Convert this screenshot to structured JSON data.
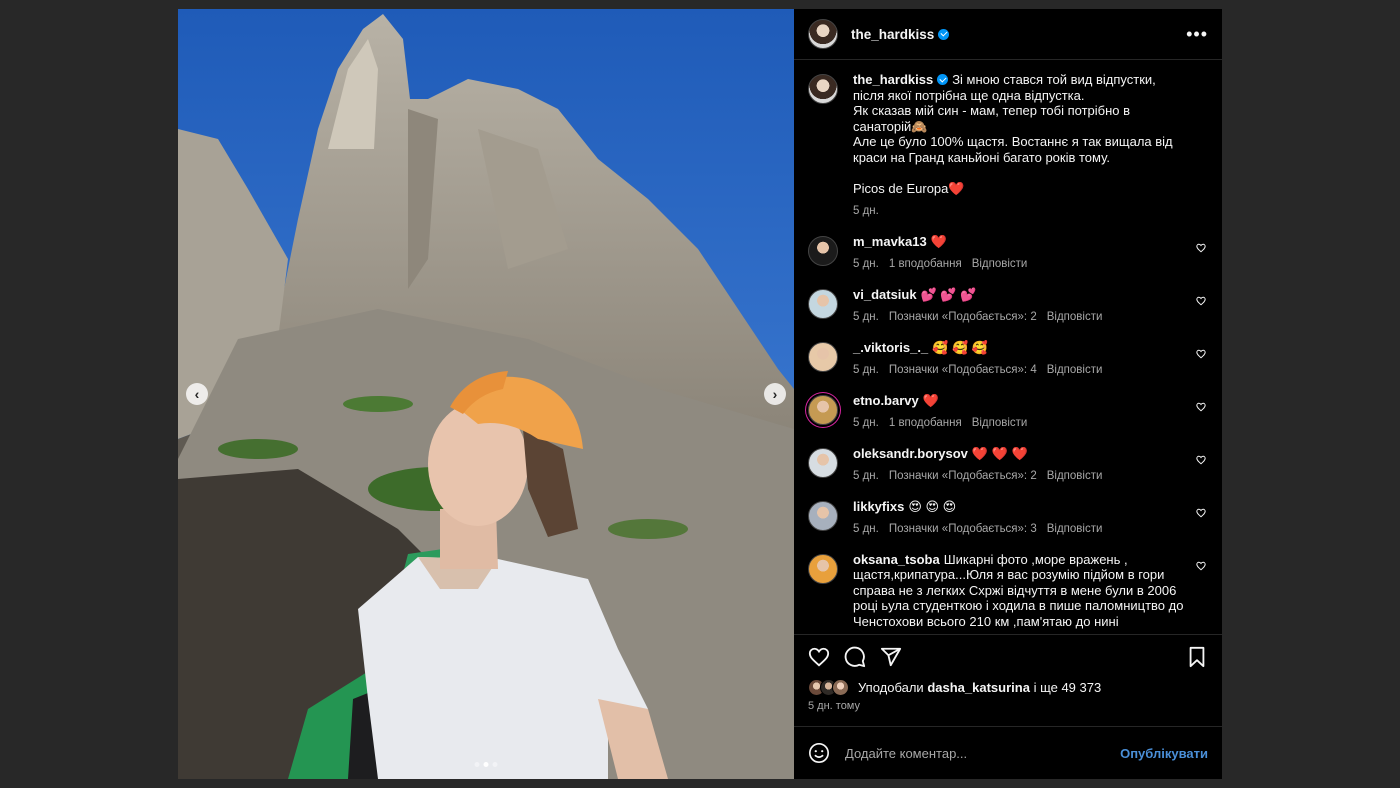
{
  "post": {
    "author": "the_hardkiss",
    "caption": "Зі мною стався той вид відпустки, після якої потрібна ще одна відпустка.\nЯк сказав мій син - мам, тепер тобі потрібно в санаторій🙈\nАле це було 100% щастя. Востаннє я так вищала від краси на Гранд каньйоні багато років тому.\n\nPicos de Europa",
    "caption_heart": "❤️",
    "caption_time": "5 дн."
  },
  "comments": [
    {
      "user": "m_mavka13",
      "text": "❤️",
      "time": "5 дн.",
      "likes": "1 вподобання",
      "reply": "Відповісти"
    },
    {
      "user": "vi_datsiuk",
      "text": "💕 💕 💕",
      "time": "5 дн.",
      "likes": "Позначки «Подобається»: 2",
      "reply": "Відповісти"
    },
    {
      "user": "_.viktoris_._",
      "text": "🥰 🥰 🥰",
      "time": "5 дн.",
      "likes": "Позначки «Подобається»: 4",
      "reply": "Відповісти"
    },
    {
      "user": "etno.barvy",
      "text": "❤️",
      "time": "5 дн.",
      "likes": "1 вподобання",
      "reply": "Відповісти"
    },
    {
      "user": "oleksandr.borysov",
      "text": "❤️ ❤️ ❤️",
      "time": "5 дн.",
      "likes": "Позначки «Подобається»: 2",
      "reply": "Відповісти"
    },
    {
      "user": "likkyfixs",
      "text": "😍 😍 😍",
      "time": "5 дн.",
      "likes": "Позначки «Подобається»: 3",
      "reply": "Відповісти"
    },
    {
      "user": "oksana_tsoba",
      "text": "Шикарні фото ,море вражень , щастя,крипатура...Юля я вас розумію підйом в гори справа не з легких Схржі відчуття в мене були в 2006 році ьула студенткою і ходила в пише паломництво до Ченстохови всього 210 км ,пам'ятаю до нині",
      "time": "",
      "likes": "",
      "reply": ""
    }
  ],
  "likes": {
    "prefix": "Уподобали",
    "user": "dasha_katsurina",
    "suffix": "і ще 49 373",
    "time": "5 дн. тому"
  },
  "comment_input": {
    "placeholder": "Додайте коментар...",
    "post_label": "Опублікувати"
  },
  "media": {
    "prev": "‹",
    "next": "›",
    "slide_count": 3,
    "active_slide": 1
  },
  "colors": {
    "accent": "#0095f6",
    "heart": "#ff3040",
    "sky": "#2f64b8"
  }
}
